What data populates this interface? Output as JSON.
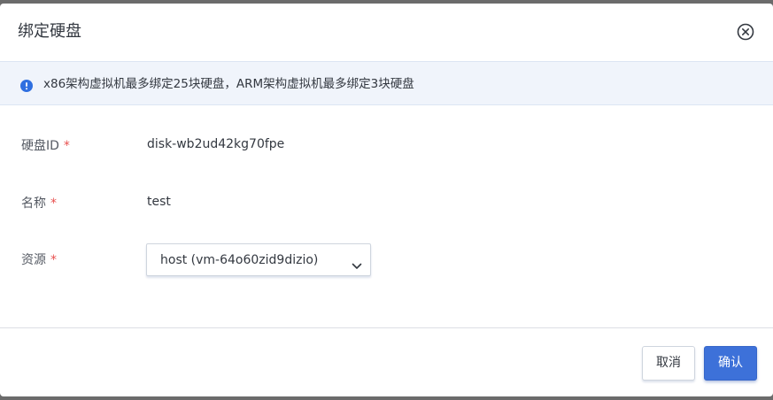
{
  "dialog": {
    "title": "绑定硬盘",
    "close_icon": "close-circle-icon"
  },
  "notice": {
    "icon": "info-circle-icon",
    "text": "x86架构虚拟机最多绑定25块硬盘，ARM架构虚拟机最多绑定3块硬盘"
  },
  "form": {
    "disk_id": {
      "label": "硬盘ID",
      "required_mark": "*",
      "value": "disk-wb2ud42kg70fpe"
    },
    "name": {
      "label": "名称",
      "required_mark": "*",
      "value": "test"
    },
    "resource": {
      "label": "资源",
      "required_mark": "*",
      "selected": "host (vm-64o60zid9dizio)",
      "icon": "chevron-down-icon"
    }
  },
  "footer": {
    "cancel_label": "取消",
    "confirm_label": "确认"
  },
  "colors": {
    "primary": "#3d71d9",
    "required": "#e8504f",
    "notice_bg": "#f0f4fb",
    "info_icon": "#2f6fe0"
  }
}
